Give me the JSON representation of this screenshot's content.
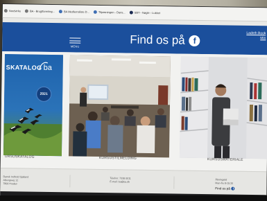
{
  "browser": {
    "bookmarks": [
      {
        "label": "Nordvirke",
        "icon": "gray"
      },
      {
        "label": "BA - Brugtforening...",
        "icon": "gray"
      },
      {
        "label": "BA Medlemsliste D...",
        "icon": "blue"
      },
      {
        "label": "Tilpasningen - Dans...",
        "icon": "blue"
      },
      {
        "label": "SBT - Nøgle - Lukket",
        "icon": "dark"
      }
    ]
  },
  "header": {
    "menu_label": "MENU",
    "findos_text": "Find os på",
    "login_line1": "Ladeth Book",
    "login_line2": "Min"
  },
  "tiles": {
    "katalog": {
      "title": "SKATALOG",
      "logo_text": "ba",
      "badge_year": "2021",
      "caption": "URSUSKATALOG"
    },
    "meeting": {
      "caption": "KURSUSTILMELDING"
    },
    "books": {
      "caption": "KURSUSMATERIALE"
    }
  },
  "footer": {
    "col1_line1": "Dansk Indhold Sjalland",
    "col1_line2": "Alborgsvej 12",
    "col1_line3": "7800 Hvalsø",
    "col2_line1": "Telefon: 7338 0011",
    "col2_line2": "E-mail: ba@ba.dk",
    "col3_line1": "Åbningstid",
    "col3_line2": "Man-fre 8-15:30",
    "col3_findos": "Find os på"
  },
  "colors": {
    "header_blue": "#1b4f9c",
    "katalog_blue": "#1b5da8"
  }
}
